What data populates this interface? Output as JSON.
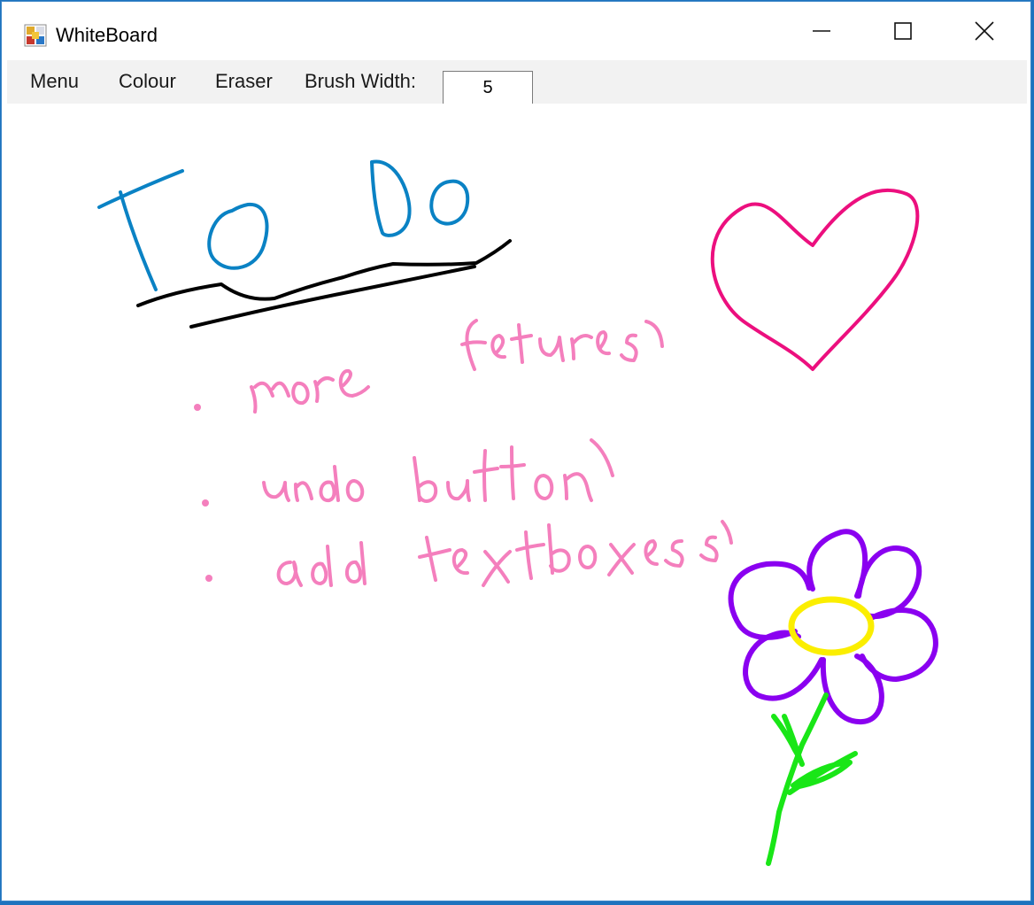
{
  "window": {
    "title": "WhiteBoard",
    "icon": "app-icon"
  },
  "caption_buttons": {
    "minimize_icon": "minimize-icon",
    "maximize_icon": "maximize-icon",
    "close_icon": "close-icon"
  },
  "menubar": {
    "items": [
      {
        "label": "Menu"
      },
      {
        "label": "Colour"
      },
      {
        "label": "Eraser"
      }
    ],
    "brush_width_label": "Brush Width:",
    "brush_width_value": "5"
  },
  "canvas": {
    "drawing": {
      "title_text": "To Do",
      "bullets": [
        "more features",
        "undo button",
        "add textboxes"
      ]
    },
    "colors": {
      "title": "#0a82c4",
      "underline": "#000000",
      "bullets": "#f47fbd",
      "heart": "#ec0f7e",
      "petals": "#8a00f0",
      "flower_center": "#fbee00",
      "stem": "#19e617"
    }
  },
  "colors": {
    "window_border": "#3a86c8",
    "menubar_bg": "#f2f2f2",
    "titlebar_bg": "#ffffff"
  }
}
